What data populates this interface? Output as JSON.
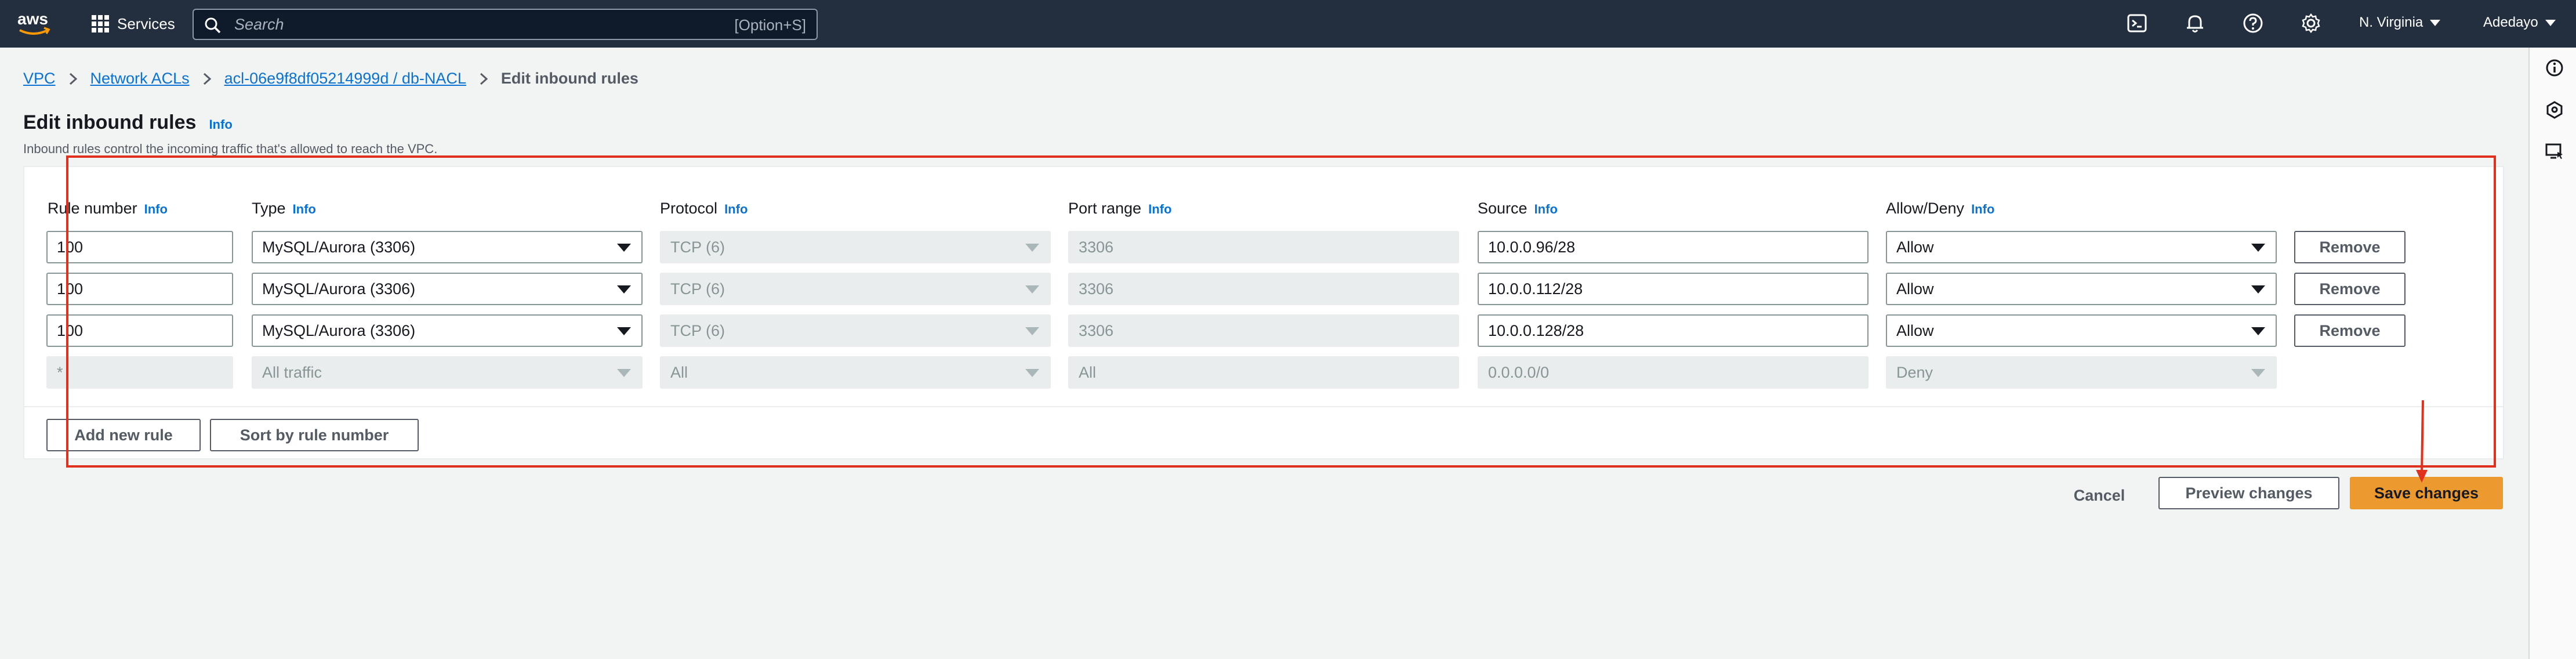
{
  "topnav": {
    "logo_text": "aws",
    "services_label": "Services",
    "search_placeholder": "Search",
    "search_shortcut": "[Option+S]",
    "icons": [
      "cloudshell-icon",
      "bell-icon",
      "help-icon",
      "gear-icon"
    ],
    "region": "N. Virginia",
    "user": "Adedayo"
  },
  "breadcrumb": [
    "VPC",
    "Network ACLs",
    "acl-06e9f8df05214999d / db-NACL",
    "Edit inbound rules"
  ],
  "page": {
    "title": "Edit inbound rules",
    "title_info": "Info",
    "description": "Inbound rules control the incoming traffic that's allowed to reach the VPC."
  },
  "columns": [
    {
      "label": "Rule number",
      "info": "Info"
    },
    {
      "label": "Type",
      "info": "Info"
    },
    {
      "label": "Protocol",
      "info": "Info"
    },
    {
      "label": "Port range",
      "info": "Info"
    },
    {
      "label": "Source",
      "info": "Info"
    },
    {
      "label": "Allow/Deny",
      "info": "Info"
    }
  ],
  "rules": [
    {
      "number": "100",
      "type": "MySQL/Aurora (3306)",
      "protocol": "TCP (6)",
      "port_range": "3306",
      "source": "10.0.0.96/28",
      "action": "Allow",
      "remove_label": "Remove"
    },
    {
      "number": "100",
      "type": "MySQL/Aurora (3306)",
      "protocol": "TCP (6)",
      "port_range": "3306",
      "source": "10.0.0.112/28",
      "action": "Allow",
      "remove_label": "Remove"
    },
    {
      "number": "100",
      "type": "MySQL/Aurora (3306)",
      "protocol": "TCP (6)",
      "port_range": "3306",
      "source": "10.0.0.128/28",
      "action": "Allow",
      "remove_label": "Remove"
    }
  ],
  "default_rule": {
    "number": "*",
    "type": "All traffic",
    "protocol": "All",
    "port_range": "All",
    "source": "0.0.0.0/0",
    "action": "Deny"
  },
  "actions": {
    "add_rule": "Add new rule",
    "sort": "Sort by rule number",
    "cancel": "Cancel",
    "preview": "Preview changes",
    "save": "Save changes"
  },
  "colors": {
    "nav_bg": "#232f3e",
    "link": "#0972d3",
    "primary_button": "#ec9a2f",
    "annotation": "#e0301e"
  }
}
